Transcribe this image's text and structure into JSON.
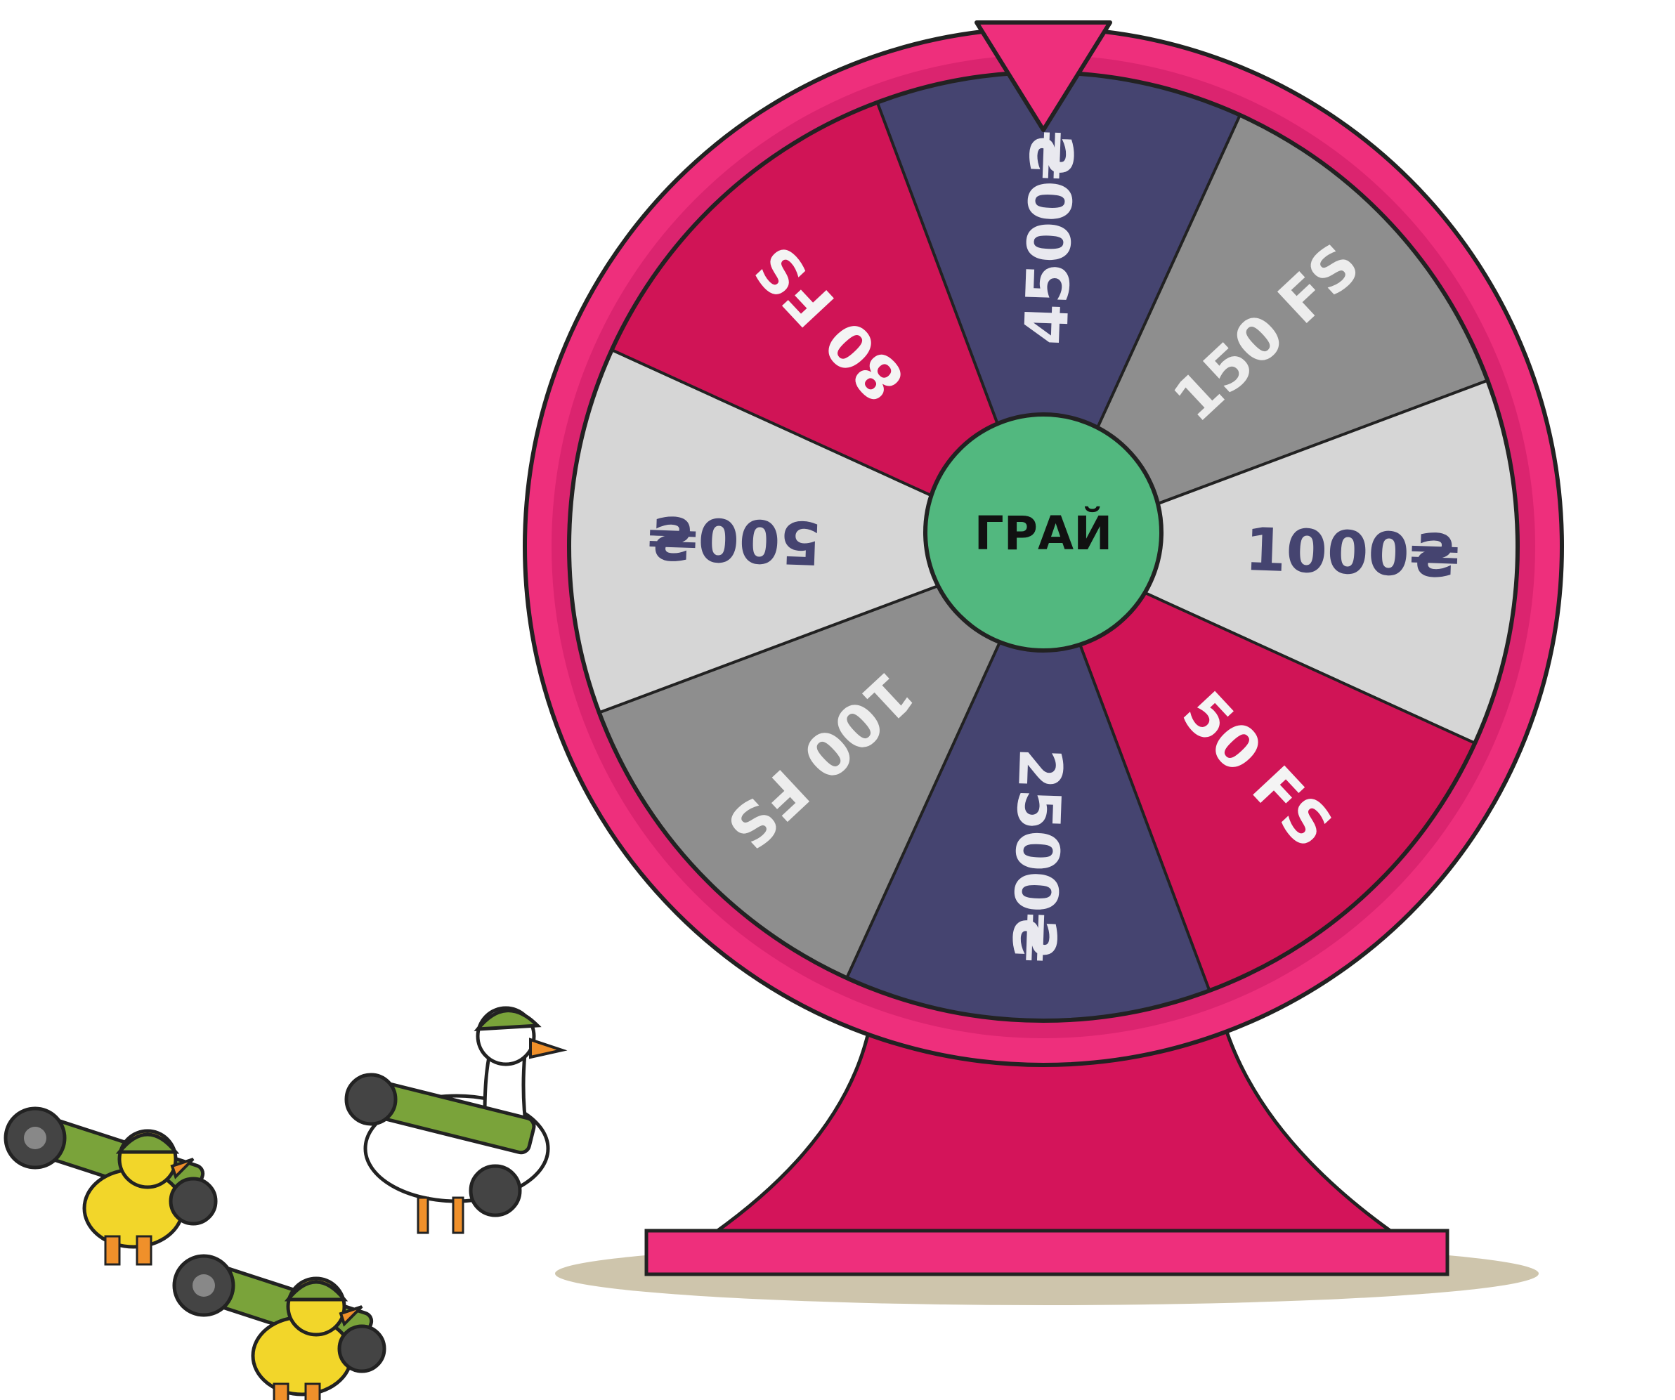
{
  "wheel": {
    "spin_button_label": "ГРАЙ",
    "segments": [
      {
        "label": "4500₴",
        "fill": "#454470",
        "text_color": "#e9e9ef"
      },
      {
        "label": "150 FS",
        "fill": "#8e8e8e",
        "text_color": "#ededed"
      },
      {
        "label": "1000₴",
        "fill": "#d6d6d6",
        "text_color": "#454470"
      },
      {
        "label": "50 FS",
        "fill": "#d01456",
        "text_color": "#f4f4f4"
      },
      {
        "label": "2500₴",
        "fill": "#454470",
        "text_color": "#e9e9ef"
      },
      {
        "label": "100 FS",
        "fill": "#8e8e8e",
        "text_color": "#ededed"
      },
      {
        "label": "500₴",
        "fill": "#d6d6d6",
        "text_color": "#454470"
      },
      {
        "label": "80 FS",
        "fill": "#d01456",
        "text_color": "#f4f4f4"
      }
    ]
  },
  "colors": {
    "rim": "#ee2f7c",
    "rim_dark": "#b8125a",
    "stand": "#d4145a",
    "spin_button": "#52b87f",
    "pointer": "#ee2f7c",
    "shadow": "#c9bfa3"
  },
  "characters": [
    {
      "icon": "duck-with-bazooka-icon"
    },
    {
      "icon": "duck-with-bazooka-icon"
    },
    {
      "icon": "goose-with-bazooka-icon"
    }
  ]
}
